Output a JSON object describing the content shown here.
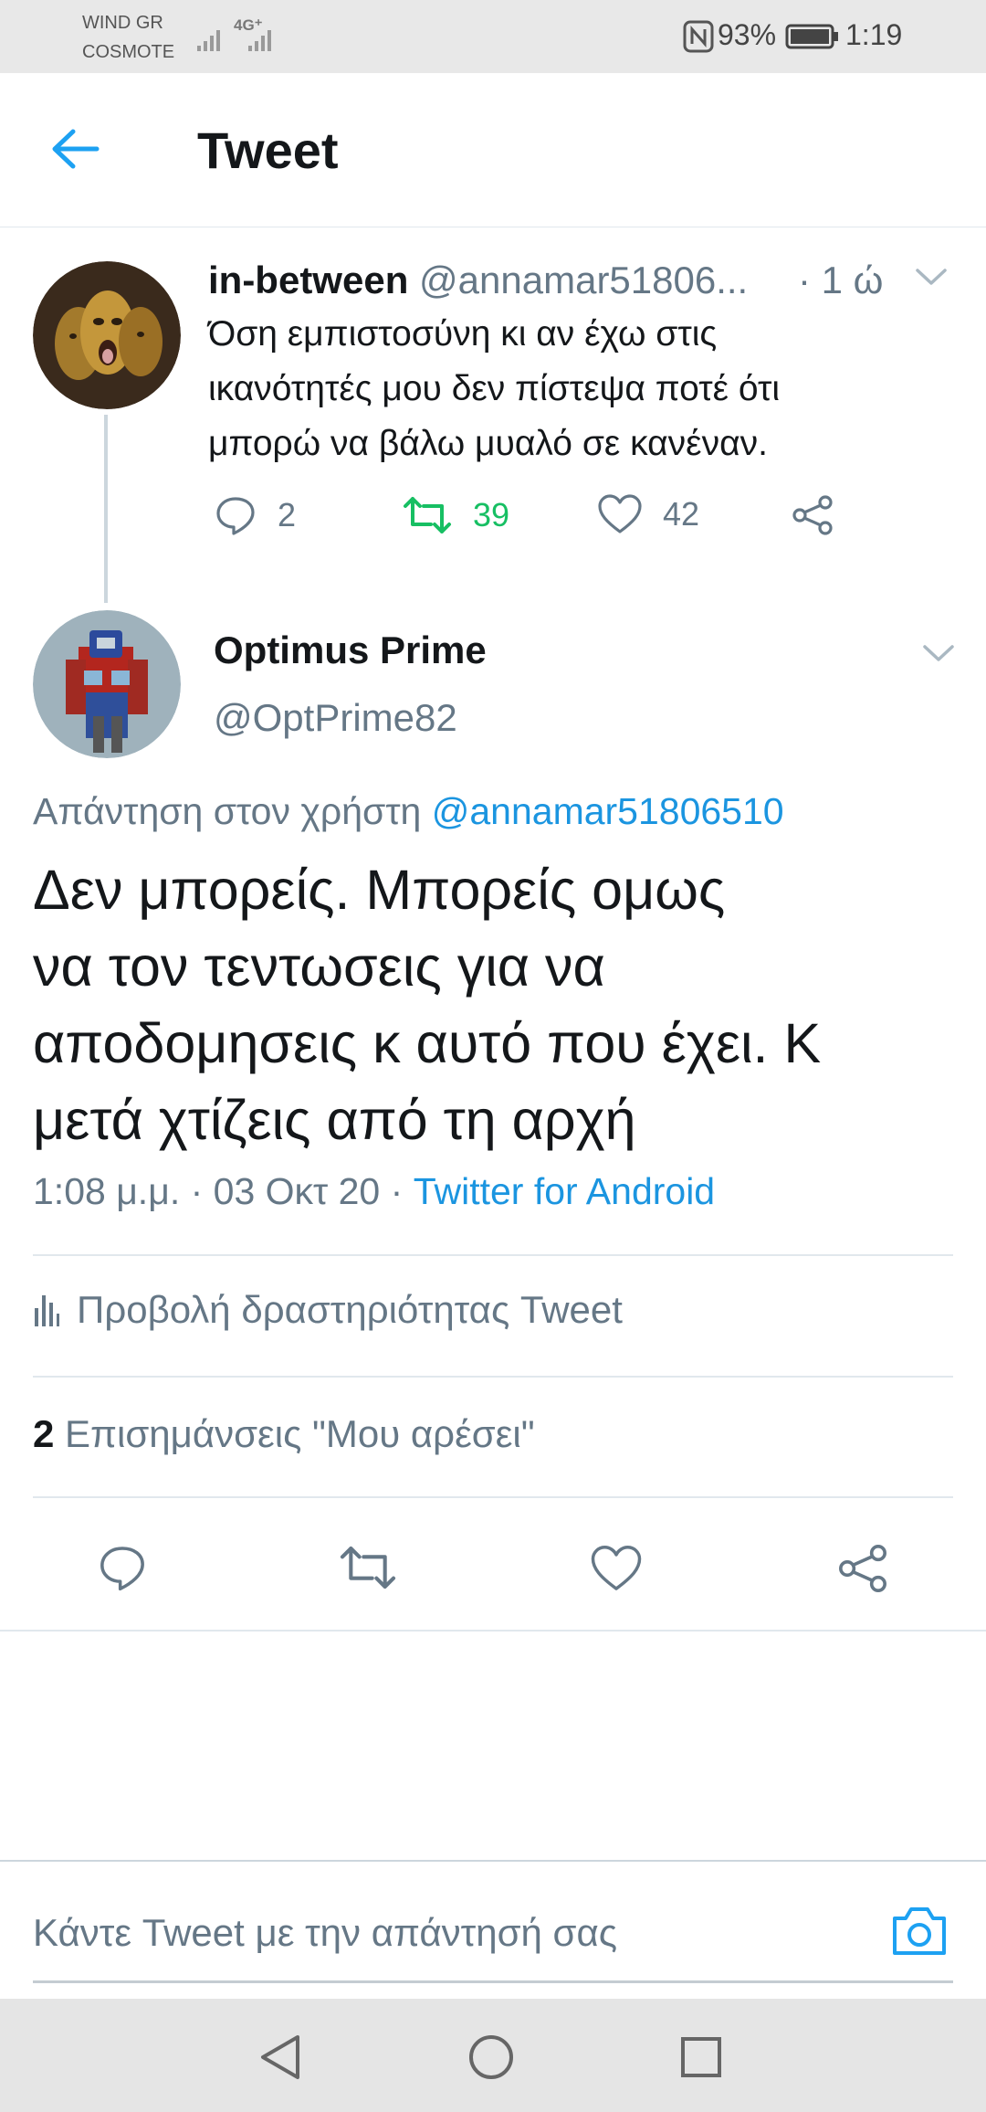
{
  "status_bar": {
    "carrier1": "WIND GR",
    "carrier2": "COSMOTE",
    "network": "4G⁺",
    "battery": "93%",
    "time": "1:19"
  },
  "header": {
    "title": "Tweet"
  },
  "parent_tweet": {
    "name": "in-between",
    "handle": "@annamar51806...",
    "time": "· 1 ώ",
    "text_lines": [
      "Όση εμπιστοσύνη κι αν έχω στις",
      "ικανότητές μου δεν πίστεψα ποτέ ότι",
      "μπορώ να βάλω μυαλό σε κανέναν."
    ],
    "replies": "2",
    "retweets": "39",
    "likes": "42"
  },
  "main_tweet": {
    "name": "Optimus Prime",
    "handle": "@OptPrime82",
    "reply_prefix": "Απάντηση στον χρήστη",
    "reply_to": "@annamar51806510",
    "text_lines": [
      "Δεν μπορείς. Μπορείς ομως",
      "να τον τεντωσεις για να",
      "αποδομησεις κ αυτό που έχει. Κ",
      "μετά χτίζεις από τη αρχή"
    ],
    "timestamp": "1:08 μ.μ. · 03 Οκτ 20 ·",
    "source": "Twitter for Android",
    "activity_label": "Προβολή δραστηριότητας Tweet",
    "likes_count": "2",
    "likes_label": "Επισημάνσεις \"Μου αρέσει\""
  },
  "composer": {
    "placeholder": "Κάντε Tweet με την απάντησή σας"
  },
  "colors": {
    "accent": "#1da1f2",
    "retweet_green": "#17bf63",
    "muted": "#657786"
  }
}
